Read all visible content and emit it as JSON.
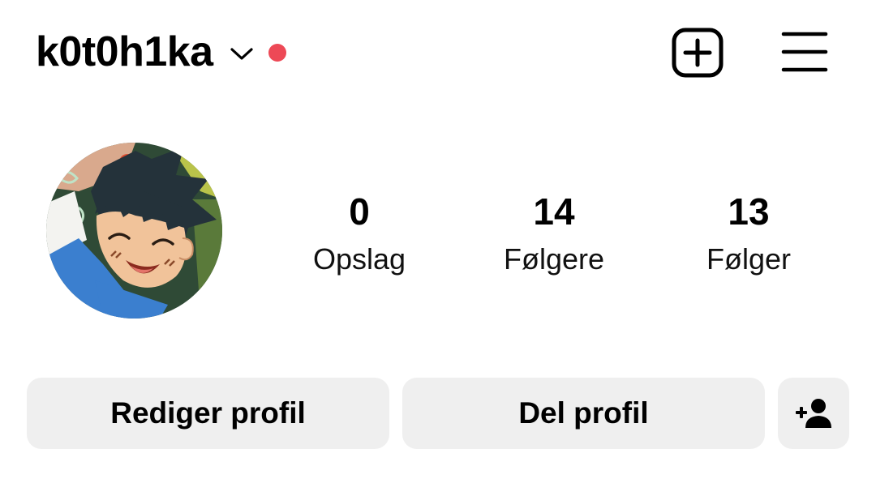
{
  "header": {
    "username": "k0t0h1ka",
    "chevron_icon": "chevron-down-icon",
    "notification_dot_color": "#ed4956",
    "create_icon": "plus-square-icon",
    "menu_icon": "hamburger-menu-icon"
  },
  "profile": {
    "avatar_alt": "profile-picture",
    "stats": [
      {
        "value": "0",
        "label": "Opslag"
      },
      {
        "value": "14",
        "label": "Følgere"
      },
      {
        "value": "13",
        "label": "Følger"
      }
    ]
  },
  "actions": {
    "edit_label": "Rediger profil",
    "share_label": "Del profil",
    "add_person_icon": "add-person-icon",
    "button_bg": "#efefef"
  }
}
